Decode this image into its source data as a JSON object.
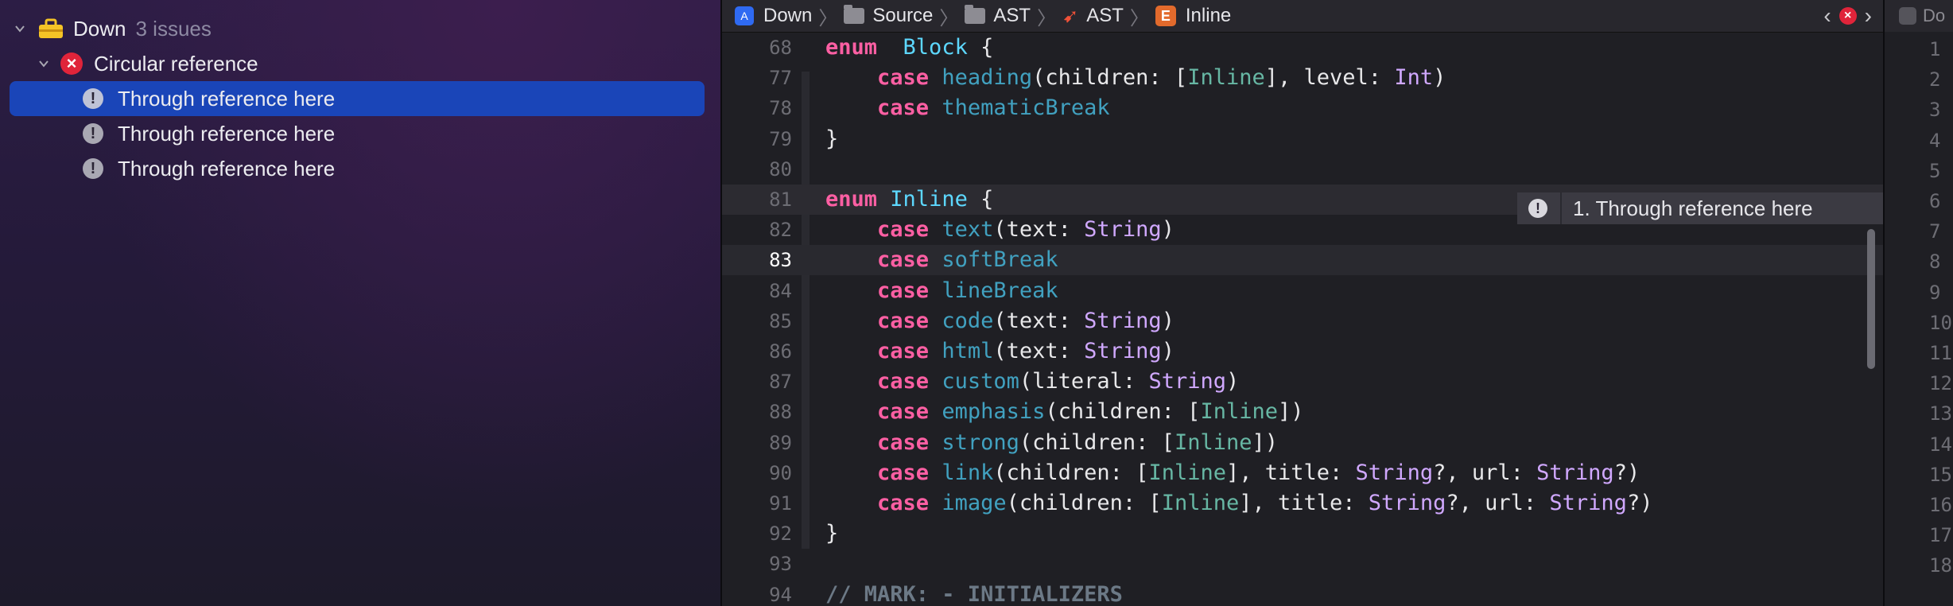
{
  "navigator": {
    "project": {
      "name": "Down",
      "count": "3 issues"
    },
    "issue": {
      "title": "Circular reference"
    },
    "children": [
      {
        "label": "Through reference here",
        "selected": true
      },
      {
        "label": "Through reference here",
        "selected": false
      },
      {
        "label": "Through reference here",
        "selected": false
      }
    ]
  },
  "jumpbar": {
    "items": [
      "Down",
      "Source",
      "AST",
      "AST",
      "Inline"
    ],
    "enum_badge": "E",
    "app_badge": "A"
  },
  "editor": {
    "issue_banner": "1. Through reference here",
    "lines": [
      {
        "n": "68",
        "tokens": [
          [
            "kw",
            "enum"
          ],
          [
            "",
            "  "
          ],
          [
            "ty",
            "Block"
          ],
          [
            "",
            " {"
          ]
        ]
      },
      {
        "n": "77",
        "tokens": [
          [
            "",
            "    "
          ],
          [
            "kw",
            "case"
          ],
          [
            "",
            " "
          ],
          [
            "fn",
            "heading"
          ],
          [
            "",
            "(children: ["
          ],
          [
            "tr",
            "Inline"
          ],
          [
            "",
            "], level: "
          ],
          [
            "st",
            "Int"
          ],
          [
            "",
            ")"
          ]
        ]
      },
      {
        "n": "78",
        "tokens": [
          [
            "",
            "    "
          ],
          [
            "kw",
            "case"
          ],
          [
            "",
            " "
          ],
          [
            "fn",
            "thematicBreak"
          ]
        ]
      },
      {
        "n": "79",
        "tokens": [
          [
            "",
            "}"
          ]
        ]
      },
      {
        "n": "80",
        "tokens": []
      },
      {
        "n": "81",
        "tokens": [
          [
            "kw",
            "enum"
          ],
          [
            "",
            " "
          ],
          [
            "ty",
            "Inline"
          ],
          [
            "",
            " {"
          ]
        ]
      },
      {
        "n": "82",
        "tokens": [
          [
            "",
            "    "
          ],
          [
            "kw",
            "case"
          ],
          [
            "",
            " "
          ],
          [
            "fn",
            "text"
          ],
          [
            "",
            "(text: "
          ],
          [
            "st",
            "String"
          ],
          [
            "",
            ")"
          ]
        ]
      },
      {
        "n": "83",
        "tokens": [
          [
            "",
            "    "
          ],
          [
            "kw",
            "case"
          ],
          [
            "",
            " "
          ],
          [
            "fn",
            "softBreak"
          ]
        ]
      },
      {
        "n": "84",
        "tokens": [
          [
            "",
            "    "
          ],
          [
            "kw",
            "case"
          ],
          [
            "",
            " "
          ],
          [
            "fn",
            "lineBreak"
          ]
        ]
      },
      {
        "n": "85",
        "tokens": [
          [
            "",
            "    "
          ],
          [
            "kw",
            "case"
          ],
          [
            "",
            " "
          ],
          [
            "fn",
            "code"
          ],
          [
            "",
            "(text: "
          ],
          [
            "st",
            "String"
          ],
          [
            "",
            ")"
          ]
        ]
      },
      {
        "n": "86",
        "tokens": [
          [
            "",
            "    "
          ],
          [
            "kw",
            "case"
          ],
          [
            "",
            " "
          ],
          [
            "fn",
            "html"
          ],
          [
            "",
            "(text: "
          ],
          [
            "st",
            "String"
          ],
          [
            "",
            ")"
          ]
        ]
      },
      {
        "n": "87",
        "tokens": [
          [
            "",
            "    "
          ],
          [
            "kw",
            "case"
          ],
          [
            "",
            " "
          ],
          [
            "fn",
            "custom"
          ],
          [
            "",
            "(literal: "
          ],
          [
            "st",
            "String"
          ],
          [
            "",
            ")"
          ]
        ]
      },
      {
        "n": "88",
        "tokens": [
          [
            "",
            "    "
          ],
          [
            "kw",
            "case"
          ],
          [
            "",
            " "
          ],
          [
            "fn",
            "emphasis"
          ],
          [
            "",
            "(children: ["
          ],
          [
            "tr",
            "Inline"
          ],
          [
            "",
            "])"
          ]
        ]
      },
      {
        "n": "89",
        "tokens": [
          [
            "",
            "    "
          ],
          [
            "kw",
            "case"
          ],
          [
            "",
            " "
          ],
          [
            "fn",
            "strong"
          ],
          [
            "",
            "(children: ["
          ],
          [
            "tr",
            "Inline"
          ],
          [
            "",
            "])"
          ]
        ]
      },
      {
        "n": "90",
        "tokens": [
          [
            "",
            "    "
          ],
          [
            "kw",
            "case"
          ],
          [
            "",
            " "
          ],
          [
            "fn",
            "link"
          ],
          [
            "",
            "(children: ["
          ],
          [
            "tr",
            "Inline"
          ],
          [
            "",
            "], title: "
          ],
          [
            "st",
            "String"
          ],
          [
            "",
            "?, url: "
          ],
          [
            "st",
            "String"
          ],
          [
            "",
            "?)"
          ]
        ]
      },
      {
        "n": "91",
        "tokens": [
          [
            "",
            "    "
          ],
          [
            "kw",
            "case"
          ],
          [
            "",
            " "
          ],
          [
            "fn",
            "image"
          ],
          [
            "",
            "(children: ["
          ],
          [
            "tr",
            "Inline"
          ],
          [
            "",
            "], title: "
          ],
          [
            "st",
            "String"
          ],
          [
            "",
            "?, url: "
          ],
          [
            "st",
            "String"
          ],
          [
            "",
            "?)"
          ]
        ]
      },
      {
        "n": "92",
        "tokens": [
          [
            "",
            "}"
          ]
        ]
      },
      {
        "n": "93",
        "tokens": []
      },
      {
        "n": "94",
        "tokens": [
          [
            "cm",
            "// MARK: - INITIALIZERS"
          ]
        ]
      }
    ],
    "current_line": "83",
    "banner_line": "81"
  },
  "right_pane": {
    "title": "Do",
    "numbers": [
      "1",
      "2",
      "3",
      "4",
      "5",
      "6",
      "7",
      "8",
      "9",
      "10",
      "11",
      "12",
      "13",
      "14",
      "15",
      "16",
      "17",
      "18"
    ]
  },
  "colors": {
    "selection": "#1a45b8",
    "error": "#e0243a",
    "keyword": "#fc5fa3",
    "type_decl": "#5dd8ff",
    "type_ref": "#67b7a4",
    "function": "#41a1c0",
    "string_type": "#d0a8ff"
  }
}
